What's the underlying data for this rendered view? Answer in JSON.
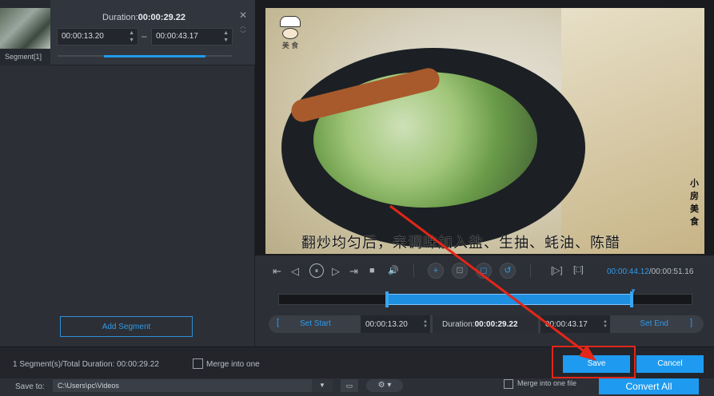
{
  "segment": {
    "label": "Segment[1]",
    "duration_label": "Duration:",
    "duration_value": "00:00:29.22",
    "start": "00:00:13.20",
    "end": "00:00:43.17",
    "dash": "–",
    "close_glyph": "✕",
    "up_glyph": "︿",
    "down_glyph": "﹀"
  },
  "add_segment_label": "Add Segment",
  "video": {
    "logo_text": "美  食",
    "logo_top": "小房",
    "side_text": "小房美食",
    "subtitle": "翻炒均匀后，来调味加入盐、生抽、蚝油、陈醋"
  },
  "controls": {
    "icons": {
      "prev": "⇤",
      "step_back": "◁",
      "play": "⏸",
      "step_fwd": "▷",
      "next": "⇥",
      "stop": "■",
      "volume": "🔊",
      "add": "+",
      "split": "⊡",
      "mark": "◻",
      "reset": "↺",
      "mark_in": "[▷]",
      "mark_out": "[□]"
    },
    "current_time": "00:00:44.12",
    "total_time": "/00:00:51.16",
    "set_start": "Set Start",
    "set_end": "Set End",
    "bracket_left": "[",
    "bracket_right": "]",
    "start_value": "00:00:13.20",
    "duration_label": "Duration:",
    "duration_value": "00:00:29.22",
    "end_value": "00:00:43.17"
  },
  "bottom": {
    "status": "1 Segment(s)/Total Duration: 00:00:29.22",
    "merge_label": "Merge into one",
    "save": "Save",
    "cancel": "Cancel"
  },
  "footer": {
    "save_to_label": "Save to:",
    "save_to_path": "C:\\Users\\pc\\Videos",
    "dropdown_glyph": "▼",
    "folder_glyph": "▭",
    "gear_glyph": "⚙ ▾",
    "merge_one_file": "Merge into one file",
    "convert_all": "Convert All"
  },
  "colors": {
    "accent": "#1e9bf0",
    "highlight": "#e32618"
  }
}
